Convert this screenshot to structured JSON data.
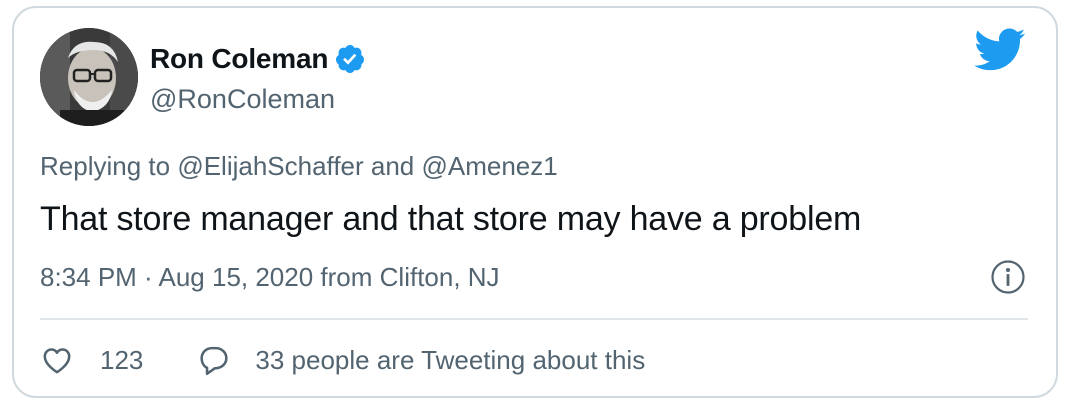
{
  "author": {
    "display_name": "Ron Coleman",
    "handle": "@RonColeman",
    "verified": true
  },
  "reply": {
    "prefix": "Replying to ",
    "mention1": "@ElijahSchaffer",
    "conjunction": " and ",
    "mention2": "@Amenez1"
  },
  "tweet": {
    "text": "That store manager and that store may have a problem",
    "meta": "8:34 PM · Aug 15, 2020 from Clifton, NJ"
  },
  "stats": {
    "likes": "123",
    "tweeting_text": "33 people are Tweeting about this"
  },
  "icons": {
    "verified": "verified-badge-icon",
    "brand": "twitter-bird-icon",
    "info": "info-icon",
    "like": "heart-icon",
    "reply": "speech-bubble-icon"
  },
  "colors": {
    "brand": "#1d9bf0",
    "text_primary": "#0f1419",
    "text_secondary": "#536471",
    "border": "#cfd9de"
  }
}
